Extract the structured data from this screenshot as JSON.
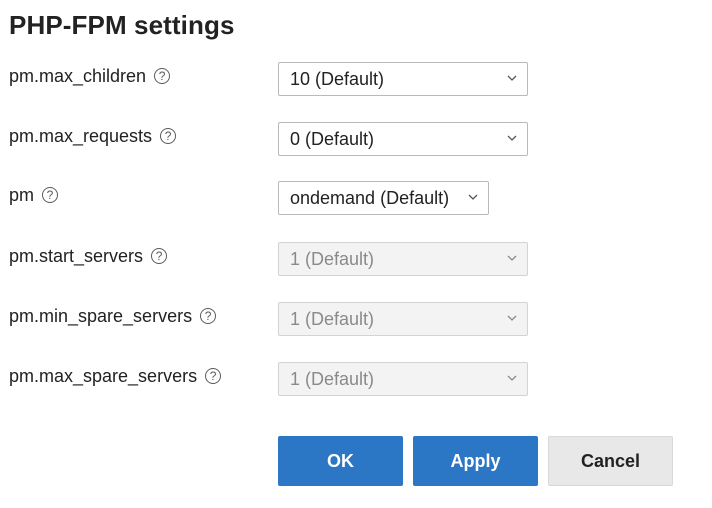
{
  "header": {
    "title": "PHP-FPM settings"
  },
  "settings": [
    {
      "label": "pm.max_children",
      "value": "10 (Default)",
      "disabled": false
    },
    {
      "label": "pm.max_requests",
      "value": "0 (Default)",
      "disabled": false
    },
    {
      "label": "pm",
      "value": "ondemand (Default)",
      "disabled": false
    },
    {
      "label": "pm.start_servers",
      "value": "1 (Default)",
      "disabled": true
    },
    {
      "label": "pm.min_spare_servers",
      "value": "1 (Default)",
      "disabled": true
    },
    {
      "label": "pm.max_spare_servers",
      "value": "1 (Default)",
      "disabled": true
    }
  ],
  "icons": {
    "help": "help-icon",
    "dropdown": "chevron-down-icon"
  },
  "help_glyph": "?",
  "buttons": {
    "ok": "OK",
    "apply": "Apply",
    "cancel": "Cancel"
  },
  "colors": {
    "primary": "#2b76c5",
    "secondary": "#e8e8e8",
    "disabled_bg": "#f3f3f3"
  }
}
